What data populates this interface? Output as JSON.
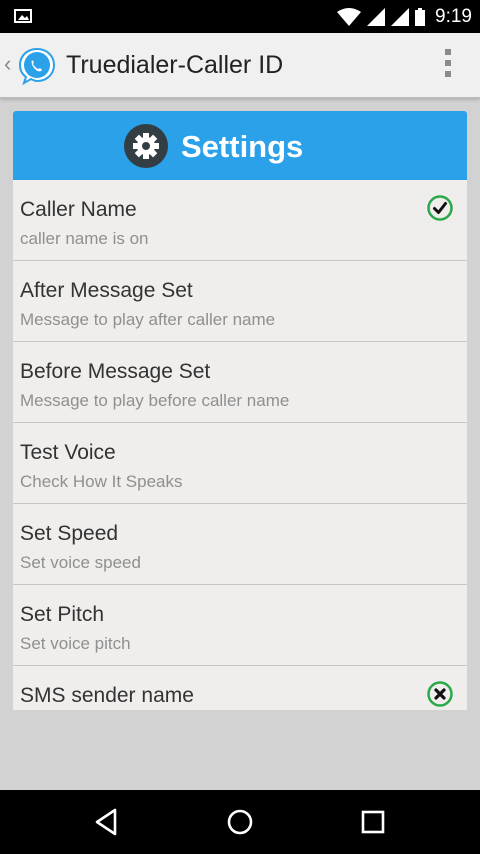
{
  "status_bar": {
    "time": "9:19"
  },
  "app_bar": {
    "title": "Truedialer-Caller ID",
    "up_glyph": "‹"
  },
  "card": {
    "header_title": "Settings"
  },
  "preferences": [
    {
      "title": "Caller Name",
      "summary": "caller name is on",
      "indicator": "check"
    },
    {
      "title": "After Message Set",
      "summary": "Message to play after caller name"
    },
    {
      "title": "Before Message Set",
      "summary": "Message to play before caller name"
    },
    {
      "title": "Test Voice",
      "summary": "Check How It Speaks"
    },
    {
      "title": "Set Speed",
      "summary": "Set voice speed"
    },
    {
      "title": "Set Pitch",
      "summary": "Set voice pitch"
    },
    {
      "title": "SMS sender name",
      "summary": "",
      "indicator": "cross"
    }
  ],
  "colors": {
    "header_blue": "#2ba1e9",
    "indicator_green": "#2aa84a",
    "card_bg": "#f0eeec"
  },
  "icons": {
    "notification": "image-notification-icon",
    "wifi": "wifi-icon",
    "signal": "cell-signal-icon",
    "battery": "battery-icon",
    "app_logo": "speech-bubble-logo-icon",
    "overflow": "overflow-menu-icon",
    "settings": "gear-icon",
    "enabled": "check-circle-icon",
    "disabled": "cross-circle-icon",
    "back": "back-nav-icon",
    "home": "home-nav-icon",
    "recents": "recents-nav-icon"
  }
}
